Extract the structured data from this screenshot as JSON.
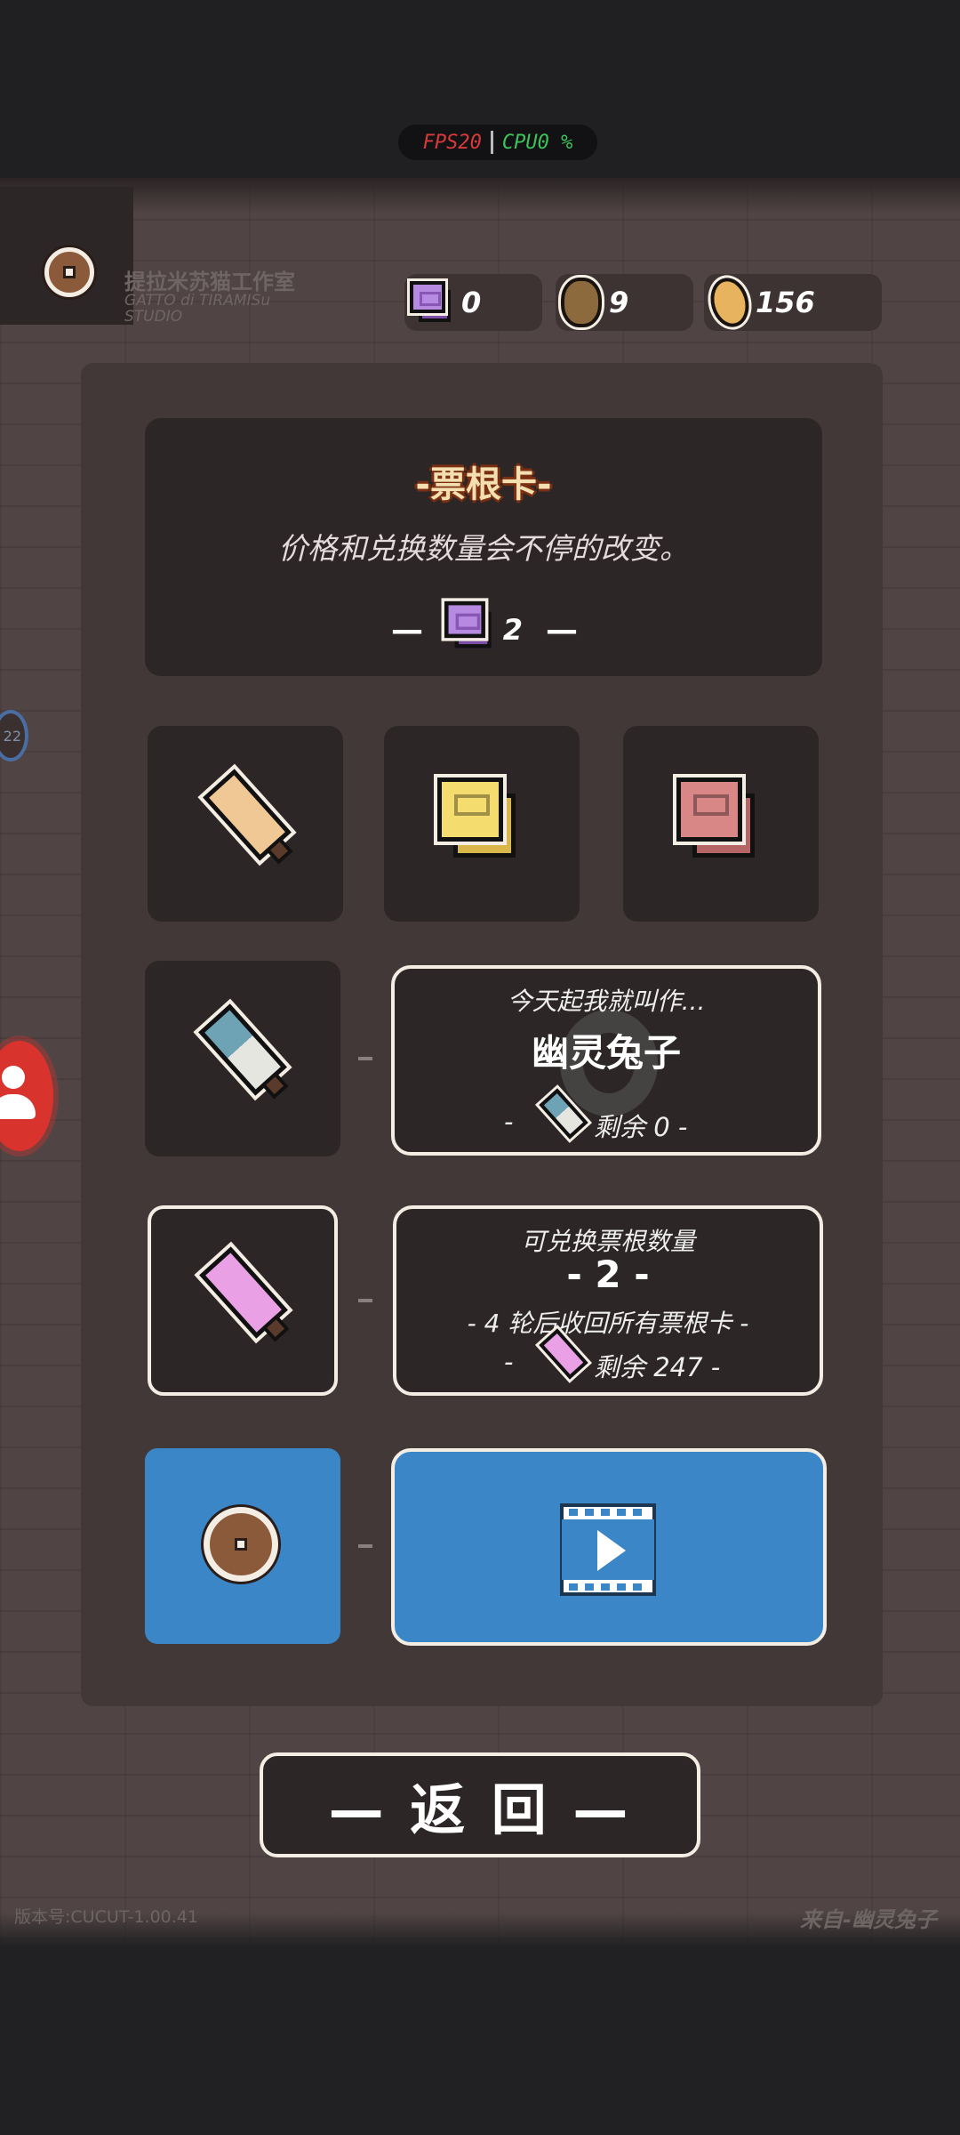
{
  "status_overlay": {
    "fps_label": "FPS20",
    "cpu_label": "CPU0 %"
  },
  "studio": {
    "name_cn": "提拉米苏猫工作室",
    "name_en_1": "GATTO di TIRAMISu",
    "name_en_2": "STUDIO"
  },
  "currencies": [
    {
      "icon": "purple-ticket-icon",
      "value": "0"
    },
    {
      "icon": "potato-icon",
      "value": "9"
    },
    {
      "icon": "egg-icon",
      "value": "156"
    }
  ],
  "header": {
    "title": "-票根卡-",
    "subtitle": "价格和兑换数量会不停的改变。",
    "price_value": "2"
  },
  "item_slots": [
    {
      "icon": "orange-crayon-icon",
      "color": "#f0c896"
    },
    {
      "icon": "yellow-ticket-icon",
      "color": "#f5dc6e"
    },
    {
      "icon": "red-ticket-icon",
      "color": "#d98786"
    }
  ],
  "ghost_rabbit_card": {
    "line1": "今天起我就叫作...",
    "title": "幽灵兔子",
    "remain_prefix": "-",
    "remain_text": "剩余 0 -"
  },
  "exchange_card": {
    "line1": "可兑换票根数量",
    "count": "- 2 -",
    "rounds_text": "- 4 轮后收回所有票根卡 -",
    "remain_prefix": "-",
    "remain_text": "剩余 247 -"
  },
  "back_button": {
    "label": "— 返 回 —"
  },
  "footer": {
    "version": "版本号:CUCUT-1.00.41",
    "from": "来自-幽灵兔子"
  },
  "side": {
    "badge": "22"
  },
  "colors": {
    "blue_accent": "#3b86c7",
    "panel": "#433838",
    "card": "#2d2626",
    "title_gold": "#f3dfb0"
  }
}
